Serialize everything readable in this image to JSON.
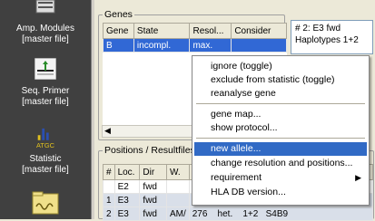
{
  "sidebar": {
    "items": [
      {
        "label_line1": "Amp. Modules",
        "label_line2": "[master file]",
        "icon": "amp-modules-icon"
      },
      {
        "label_line1": "Seq. Primer",
        "label_line2": "[master file]",
        "icon": "seq-primer-icon"
      },
      {
        "label_line1": "Statistic",
        "label_line2": "[master file]",
        "icon": "statistic-icon"
      },
      {
        "label_line1": "",
        "label_line2": "",
        "icon": "folder-icon"
      }
    ]
  },
  "genes": {
    "legend": "Genes",
    "columns": [
      "Gene",
      "State",
      "Resol...",
      "Consider"
    ],
    "rows": [
      {
        "gene": "B",
        "state": "incompl.",
        "resol": "max.",
        "consider": ""
      }
    ]
  },
  "info": {
    "line1": "# 2: E3 fwd",
    "line2": "Haplotypes 1+2"
  },
  "positions": {
    "legend": "Positions / Resultfiles",
    "columns": [
      "#",
      "Loc.",
      "Dir",
      "W."
    ],
    "rows": [
      {
        "num": "",
        "loc": "E2",
        "dir": "fwd",
        "w": "",
        "extra": ""
      },
      {
        "num": "1",
        "loc": "E3",
        "dir": "fwd",
        "w": "",
        "extra": ""
      },
      {
        "num": "2",
        "loc": "E3",
        "dir": "fwd",
        "w": "AM/",
        "extra": "276    het.    1+2   S4B9"
      }
    ],
    "e_label": "E"
  },
  "context_menu": {
    "items": [
      {
        "label": "ignore (toggle)"
      },
      {
        "label": "exclude from statistic (toggle)"
      },
      {
        "label": "reanalyse gene"
      },
      {
        "label": "gene map..."
      },
      {
        "label": "show protocol..."
      },
      {
        "label": "new allele..."
      },
      {
        "label": "change resolution and positions..."
      },
      {
        "label": "requirement"
      },
      {
        "label": "HLA DB version..."
      }
    ],
    "highlighted": "new allele...",
    "submenu_arrow": "▶"
  },
  "colors": {
    "selection": "#3168d5",
    "menu_highlight": "#316ac5",
    "sidebar_bg": "#404040"
  }
}
